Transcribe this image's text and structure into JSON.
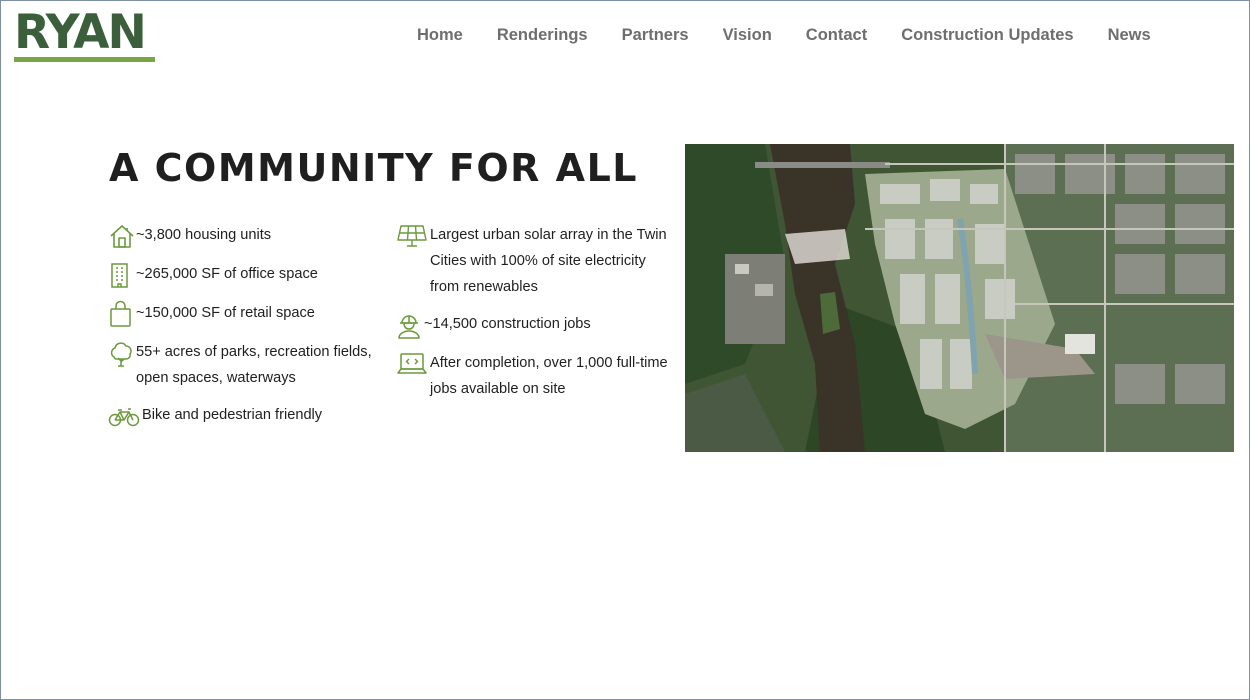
{
  "header": {
    "logo_text": "RYAN",
    "brand_green": "#3a5f3a",
    "accent_green": "#78a644",
    "nav": [
      {
        "label": "Home"
      },
      {
        "label": "Renderings"
      },
      {
        "label": "Partners"
      },
      {
        "label": "Vision"
      },
      {
        "label": "Contact"
      },
      {
        "label": "Construction Updates"
      },
      {
        "label": "News"
      }
    ]
  },
  "main": {
    "title": "A COMMUNITY FOR ALL",
    "left_features": [
      {
        "icon": "house-icon",
        "text": "~3,800 housing units"
      },
      {
        "icon": "office-building-icon",
        "text": "~265,000 SF of office space"
      },
      {
        "icon": "shopping-bag-icon",
        "text": "~150,000 SF of retail space"
      },
      {
        "icon": "tree-icon",
        "text": "55+ acres of parks, recreation fields, open spaces, waterways"
      },
      {
        "icon": "bicycle-icon",
        "text": "Bike and pedestrian friendly"
      }
    ],
    "right_features": [
      {
        "icon": "solar-panel-icon",
        "text": "Largest urban solar array in the Twin Cities with 100% of site electricity from renewables"
      },
      {
        "icon": "construction-worker-icon",
        "text": "~14,500 construction jobs"
      },
      {
        "icon": "laptop-icon",
        "text": "After completion, over 1,000 full-time jobs available on site"
      }
    ],
    "image": {
      "icon": "aerial-site-map"
    }
  }
}
